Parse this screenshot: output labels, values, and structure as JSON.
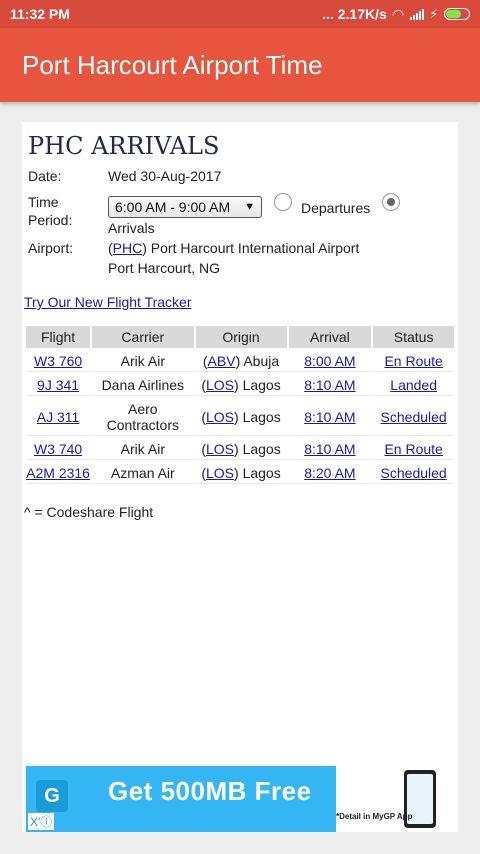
{
  "statusbar": {
    "time": "11:32 PM",
    "speed": "... 2.17K/s",
    "wifi": "wifi-icon",
    "signal": "signal-icon",
    "battery": "battery-icon"
  },
  "appbar": {
    "title": "Port Harcourt Airport Time"
  },
  "page": {
    "title": "PHC ARRIVALS",
    "date_label": "Date:",
    "date_value": "Wed 30-Aug-2017",
    "time_label_1": "Time",
    "time_label_2": "Period:",
    "time_period": "6:00 AM - 9:00 AM",
    "departures_label": "Departures",
    "arrivals_label": "Arrivals",
    "airport_label": "Airport:",
    "airport_code": "PHC",
    "airport_name": "Port Harcourt International Airport",
    "airport_city": "Port Harcourt, NG",
    "tracker_link": "Try Our New Flight Tracker",
    "codeshare_note": "^ = Codeshare Flight"
  },
  "table": {
    "headers": [
      "Flight",
      "Carrier",
      "Origin",
      "Arrival",
      "Status"
    ],
    "rows": [
      {
        "flight": "W3 760",
        "carrier": "Arik Air",
        "origin_code": "ABV",
        "origin_city": "Abuja",
        "arrival": "8:00 AM",
        "status": "En Route"
      },
      {
        "flight": "9J 341",
        "carrier": "Dana Airlines",
        "origin_code": "LOS",
        "origin_city": "Lagos",
        "arrival": "8:10 AM",
        "status": "Landed"
      },
      {
        "flight": "AJ 311",
        "carrier_1": "Aero",
        "carrier_2": "Contractors",
        "origin_code": "LOS",
        "origin_city": "Lagos",
        "arrival": "8:10 AM",
        "status": "Scheduled"
      },
      {
        "flight": "W3 740",
        "carrier": "Arik Air",
        "origin_code": "LOS",
        "origin_city": "Lagos",
        "arrival": "8:10 AM",
        "status": "En Route"
      },
      {
        "flight": "A2M 2316",
        "carrier": "Azman Air",
        "origin_code": "LOS",
        "origin_city": "Lagos",
        "arrival": "8:20 AM",
        "status": "Scheduled"
      }
    ]
  },
  "ad": {
    "headline": "Get 500MB Free",
    "note": "*Detail in MyGP App",
    "close": "X'ⓘ",
    "logo": "G"
  }
}
